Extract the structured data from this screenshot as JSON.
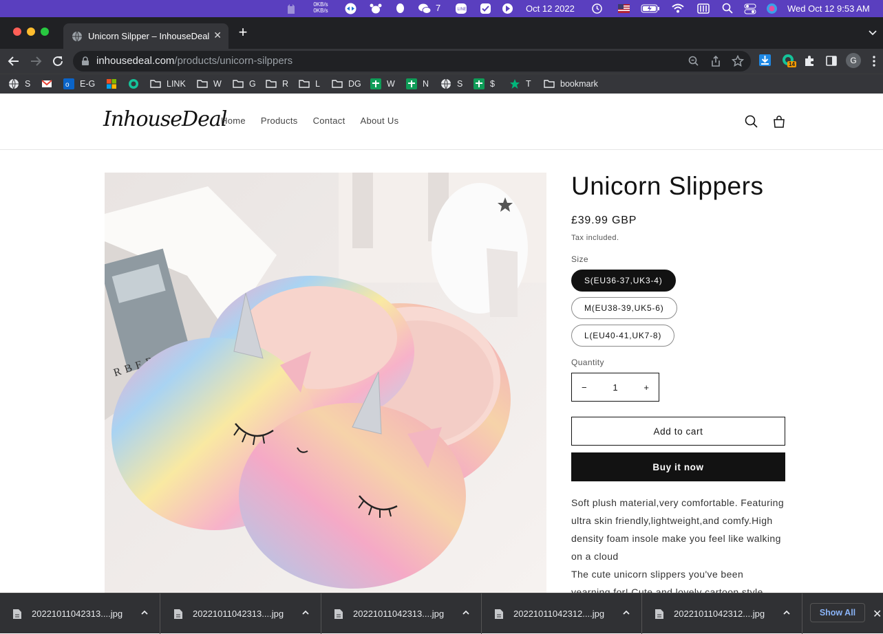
{
  "menubar": {
    "net_up": "0KB/s",
    "net_down": "0KB/s",
    "wechat_count": "7",
    "date_short": "Oct 12 2022",
    "datetime": "Wed Oct 12  9:53 AM"
  },
  "browser": {
    "tab_title": "Unicorn Silpper – InhouseDeal",
    "url_host": "inhousedeal.com",
    "url_path": "/products/unicorn-silppers",
    "extension_badge": "14",
    "profile_initial": "G",
    "bookmarks": [
      {
        "label": "S",
        "icon": "globe-icon"
      },
      {
        "label": "",
        "icon": "gmail-icon"
      },
      {
        "label": "E-G",
        "icon": "outlook-icon"
      },
      {
        "label": "",
        "icon": "microsoft-icon"
      },
      {
        "label": "",
        "icon": "grammarly-icon"
      },
      {
        "label": "LINK",
        "icon": "folder-icon"
      },
      {
        "label": "W",
        "icon": "folder-icon"
      },
      {
        "label": "G",
        "icon": "folder-icon"
      },
      {
        "label": "R",
        "icon": "folder-icon"
      },
      {
        "label": "L",
        "icon": "folder-icon"
      },
      {
        "label": "DG",
        "icon": "folder-icon"
      },
      {
        "label": "W",
        "icon": "sheet-icon"
      },
      {
        "label": "N",
        "icon": "sheet-icon"
      },
      {
        "label": "S",
        "icon": "globe-icon"
      },
      {
        "label": "$",
        "icon": "sheet-icon"
      },
      {
        "label": "T",
        "icon": "star-icon"
      },
      {
        "label": "bookmark",
        "icon": "folder-icon"
      }
    ]
  },
  "site": {
    "logo": "InhouseDeal",
    "nav": [
      "Home",
      "Products",
      "Contact",
      "About Us"
    ]
  },
  "product": {
    "title": "Unicorn Slippers",
    "price": "£39.99 GBP",
    "tax": "Tax included.",
    "size_label": "Size",
    "sizes": [
      "S(EU36-37,UK3-4)",
      "M(EU38-39,UK5-6)",
      "L(EU40-41,UK7-8)"
    ],
    "selected_size": "S(EU36-37,UK3-4)",
    "quantity_label": "Quantity",
    "quantity": "1",
    "minus": "−",
    "plus": "+",
    "add_to_cart": "Add to cart",
    "buy_now": "Buy it now",
    "description": [
      "Soft plush material,very comfortable. Featuring ultra skin friendly,lightweight,and comfy.High density foam insole make you feel like walking on a cloud",
      "The cute unicorn slippers you've been yearning for! Cute and lovely cartoon style, make your own style in your home!"
    ]
  },
  "downloads": {
    "files": [
      "20221011042313....jpg",
      "20221011042313....jpg",
      "20221011042313....jpg",
      "20221011042312....jpg",
      "20221011042312....jpg"
    ],
    "show_all": "Show All",
    "close": "✕"
  },
  "colors": {
    "menubar": "#5a3fbf",
    "chrome_dark": "#202124",
    "toolbar": "#35363a",
    "button_dark": "#121212"
  }
}
